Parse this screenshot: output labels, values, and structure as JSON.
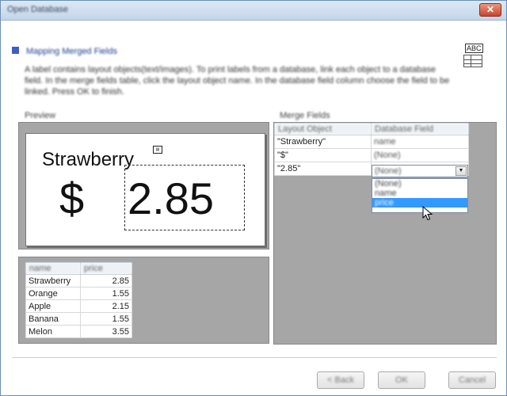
{
  "window": {
    "title": "Open Database",
    "close_glyph": "✕"
  },
  "header": {
    "heading": "Mapping Merged Fields",
    "description": "A label contains layout objects(text/images). To print labels from a database, link each object to a database field. In the merge fields table, click the layout object name. In the database field column choose the field to be linked. Press OK to finish.",
    "icon": "abc-table-icon",
    "icon_text": "ABC"
  },
  "preview": {
    "label": "Preview",
    "text1": "Strawberry",
    "dollar": "$",
    "price": "2.85",
    "object_icon": "text-object-icon"
  },
  "data_table": {
    "headers": [
      "name",
      "price"
    ],
    "rows": [
      [
        "Strawberry",
        "2.85"
      ],
      [
        "Orange",
        "1.55"
      ],
      [
        "Apple",
        "2.15"
      ],
      [
        "Banana",
        "1.55"
      ],
      [
        "Melon",
        "3.55"
      ]
    ]
  },
  "merge": {
    "label": "Merge Fields",
    "headers": [
      "Layout Object",
      "Database Field"
    ],
    "rows": [
      {
        "object": "\"Strawberry\"",
        "field": "name"
      },
      {
        "object": "\"$\"",
        "field": "(None)"
      },
      {
        "object": "\"2.85\"",
        "field": "(None)"
      }
    ],
    "dropdown_options": [
      "(None)",
      "name",
      "price"
    ],
    "dropdown_selected_index": 2
  },
  "buttons": {
    "back": "< Back",
    "ok": "OK",
    "cancel": "Cancel"
  },
  "colors": {
    "accent": "#3d5fc4",
    "selection": "#3399ff",
    "panel_gray": "#a6a6a6"
  }
}
